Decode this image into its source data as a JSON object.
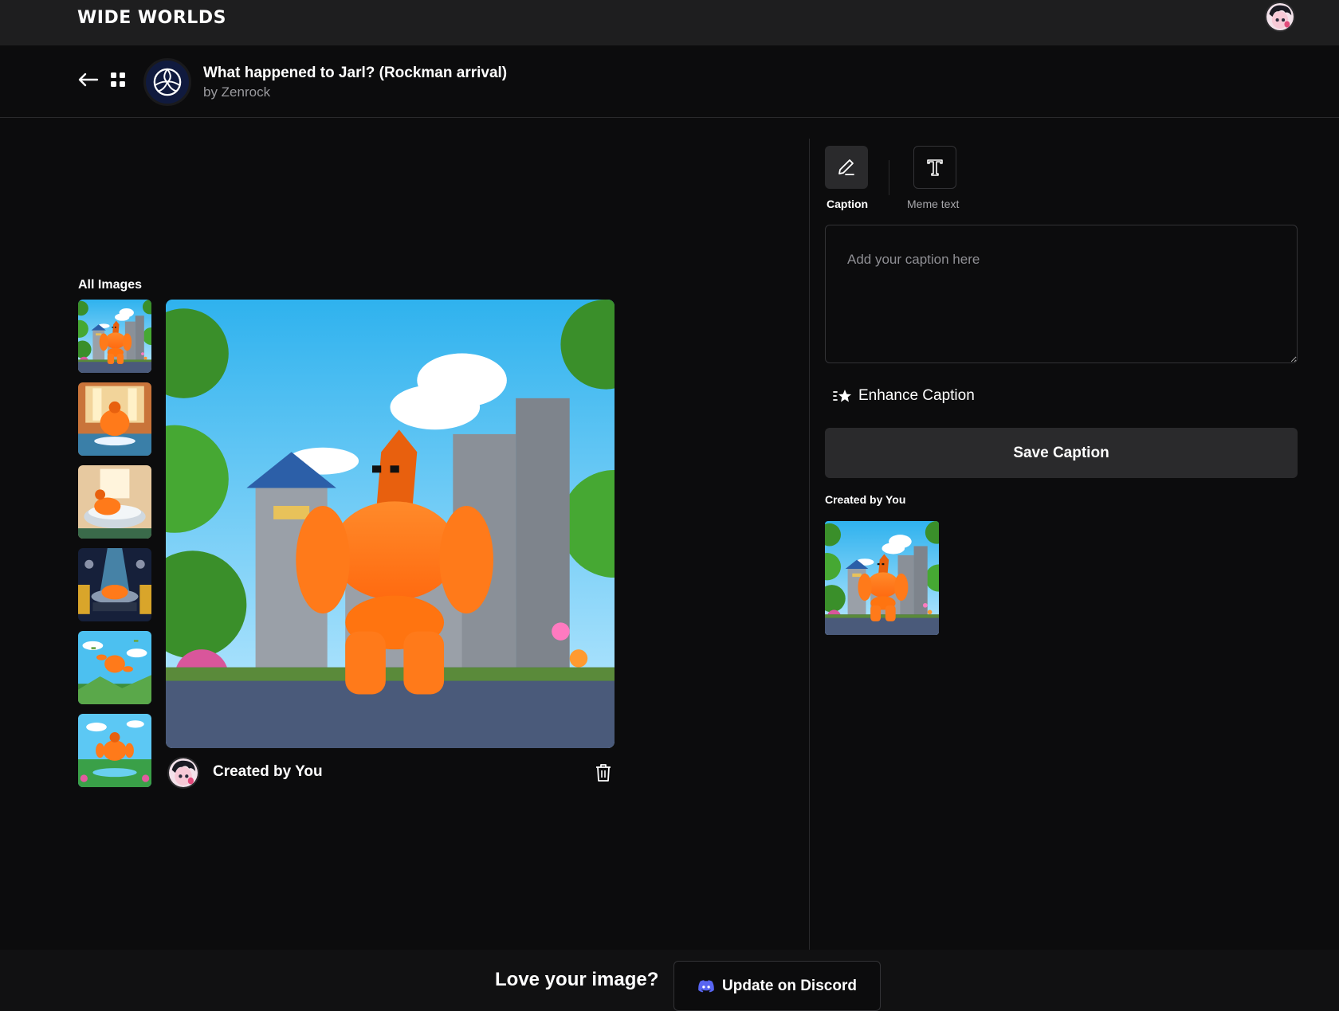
{
  "app": {
    "brand": "WIDE WORLDS"
  },
  "header": {
    "title": "What happened to Jarl? (Rockman arrival)",
    "author": "by Zenrock"
  },
  "gallery": {
    "heading": "All Images",
    "thumbnails": [
      {
        "scene": "castle-courtyard"
      },
      {
        "scene": "palace-hall"
      },
      {
        "scene": "bathtub-money"
      },
      {
        "scene": "vault-bathtub"
      },
      {
        "scene": "skydiving-money"
      },
      {
        "scene": "meadow-money"
      }
    ],
    "selected_index": 0
  },
  "main_image": {
    "creator_label": "Created by You"
  },
  "editor": {
    "tabs": [
      {
        "label": "Caption",
        "icon": "pencil-icon",
        "active": true
      },
      {
        "label": "Meme text",
        "icon": "text-t-icon",
        "active": false
      }
    ],
    "caption_placeholder": "Add your caption here",
    "caption_value": "",
    "enhance_label": "Enhance Caption",
    "save_label": "Save Caption",
    "created_label": "Created by You"
  },
  "footer": {
    "prompt": "Love your image?",
    "discord_label": "Update on Discord"
  },
  "colors": {
    "background": "#0c0c0d",
    "topbar": "#1e1e1f",
    "button": "#2a2a2c",
    "golem": "#ff7a1a",
    "discord": "#5865f2"
  }
}
